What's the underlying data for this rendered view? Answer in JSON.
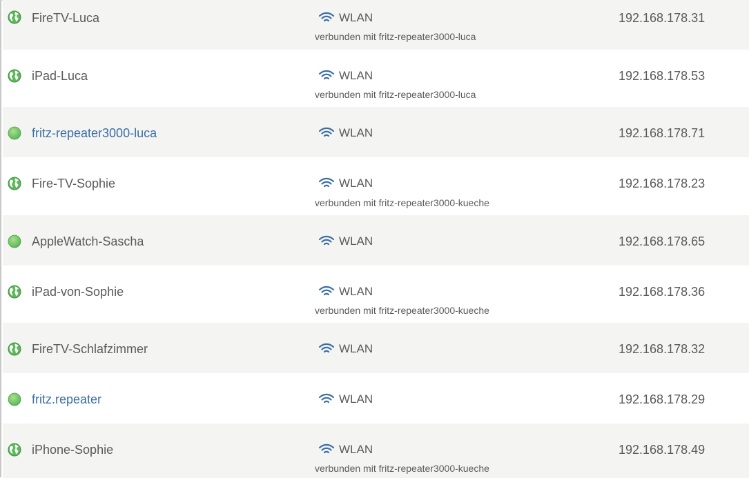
{
  "colors": {
    "row_alt_bg": "#f4f4f2",
    "text": "#5a5a5a",
    "link": "#3b6ea5",
    "status_green": "#5cb85c",
    "wifi_icon": "#3b6ea5"
  },
  "devices": [
    {
      "name": "FireTV-Luca",
      "status_icon": "globe-icon",
      "connection": "WLAN",
      "connected_to": "verbunden mit fritz-repeater3000-luca",
      "ip": "192.168.178.31",
      "is_link": false
    },
    {
      "name": "iPad-Luca",
      "status_icon": "globe-icon",
      "connection": "WLAN",
      "connected_to": "verbunden mit fritz-repeater3000-luca",
      "ip": "192.168.178.53",
      "is_link": false
    },
    {
      "name": "fritz-repeater3000-luca",
      "status_icon": "green-dot-icon",
      "connection": "WLAN",
      "connected_to": "",
      "ip": "192.168.178.71",
      "is_link": true
    },
    {
      "name": "Fire-TV-Sophie",
      "status_icon": "globe-icon",
      "connection": "WLAN",
      "connected_to": "verbunden mit fritz-repeater3000-kueche",
      "ip": "192.168.178.23",
      "is_link": false
    },
    {
      "name": "AppleWatch-Sascha",
      "status_icon": "green-dot-icon",
      "connection": "WLAN",
      "connected_to": "",
      "ip": "192.168.178.65",
      "is_link": false
    },
    {
      "name": "iPad-von-Sophie",
      "status_icon": "globe-icon",
      "connection": "WLAN",
      "connected_to": "verbunden mit fritz-repeater3000-kueche",
      "ip": "192.168.178.36",
      "is_link": false
    },
    {
      "name": "FireTV-Schlafzimmer",
      "status_icon": "globe-icon",
      "connection": "WLAN",
      "connected_to": "",
      "ip": "192.168.178.32",
      "is_link": false
    },
    {
      "name": "fritz.repeater",
      "status_icon": "green-dot-icon",
      "connection": "WLAN",
      "connected_to": "",
      "ip": "192.168.178.29",
      "is_link": true
    },
    {
      "name": "iPhone-Sophie",
      "status_icon": "globe-icon",
      "connection": "WLAN",
      "connected_to": "verbunden mit fritz-repeater3000-kueche",
      "ip": "192.168.178.49",
      "is_link": false
    }
  ]
}
